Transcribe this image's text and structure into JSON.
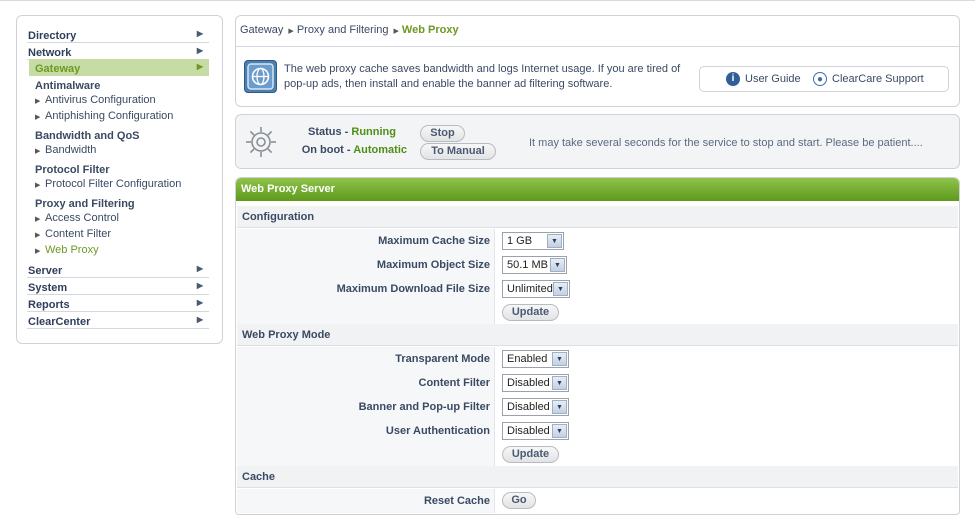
{
  "sidebar": {
    "top_items": [
      {
        "label": "Directory"
      },
      {
        "label": "Network"
      },
      {
        "label": "Gateway"
      },
      {
        "label": "Server"
      },
      {
        "label": "System"
      },
      {
        "label": "Reports"
      },
      {
        "label": "ClearCenter"
      }
    ],
    "groups": [
      {
        "title": "Antimalware",
        "items": [
          "Antivirus Configuration",
          "Antiphishing Configuration"
        ]
      },
      {
        "title": "Bandwidth and QoS",
        "items": [
          "Bandwidth"
        ]
      },
      {
        "title": "Protocol Filter",
        "items": [
          "Protocol Filter Configuration"
        ]
      },
      {
        "title": "Proxy and Filtering",
        "items": [
          "Access Control",
          "Content Filter",
          "Web Proxy"
        ]
      }
    ]
  },
  "breadcrumb": {
    "items": [
      "Gateway",
      "Proxy and Filtering"
    ],
    "current": "Web Proxy"
  },
  "info": {
    "text": "The web proxy cache saves bandwidth and logs Internet usage.  If you are tired of pop-up ads, then install and enable the banner ad filtering software.",
    "user_guide": "User Guide",
    "support": "ClearCare Support"
  },
  "status": {
    "status_label": "Status - ",
    "status_value": "Running",
    "stop_button": "Stop",
    "boot_label": "On boot - ",
    "boot_value": "Automatic",
    "manual_button": "To Manual",
    "message": "It may take several seconds for the service to stop and start.  Please be patient...."
  },
  "panel": {
    "title": "Web Proxy Server",
    "configuration": {
      "heading": "Configuration",
      "max_cache_label": "Maximum Cache Size",
      "max_cache_value": "1 GB",
      "max_object_label": "Maximum Object Size",
      "max_object_value": "50.1 MB",
      "max_download_label": "Maximum Download File Size",
      "max_download_value": "Unlimited",
      "update": "Update"
    },
    "mode": {
      "heading": "Web Proxy Mode",
      "transparent_label": "Transparent Mode",
      "transparent_value": "Enabled",
      "content_label": "Content Filter",
      "content_value": "Disabled",
      "banner_label": "Banner and Pop-up Filter",
      "banner_value": "Disabled",
      "auth_label": "User Authentication",
      "auth_value": "Disabled",
      "update": "Update"
    },
    "cache": {
      "heading": "Cache",
      "reset_label": "Reset Cache",
      "go": "Go"
    }
  },
  "colors": {
    "accent_green": "#6c9a22",
    "header_green": "#5e9a1c",
    "status_green": "#4f8f17",
    "text_navy": "#3a4a63"
  }
}
